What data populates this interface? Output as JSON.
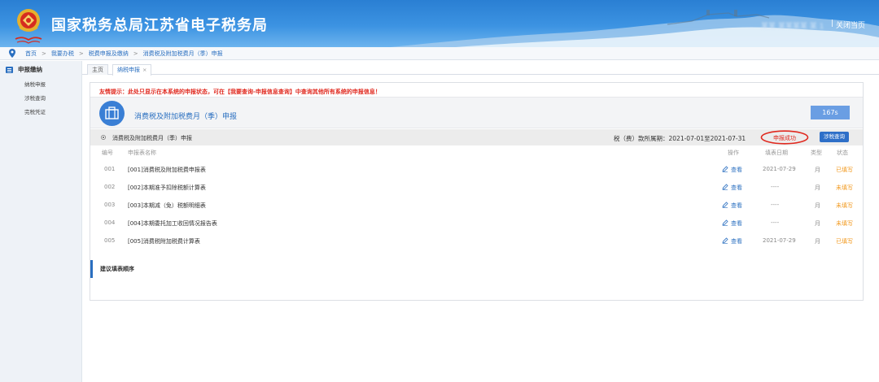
{
  "header": {
    "site_title": "国家税务总局江苏省电子税务局",
    "user_name": "某某 某某某某 某 1",
    "separator": "|",
    "close_label": "关闭当页"
  },
  "breadcrumb": [
    "首页",
    "我要办税",
    "税费申报及缴纳",
    "消费税及附加税费月（季）申报"
  ],
  "sidebar": {
    "title": "申报缴纳",
    "items": [
      {
        "label": "纳税申报"
      },
      {
        "label": "涉税查询"
      },
      {
        "label": "完税凭证"
      }
    ]
  },
  "tabs": [
    {
      "label": "主页",
      "active": false
    },
    {
      "label": "纳税申报",
      "close": "×",
      "active": true
    }
  ],
  "panel": {
    "tip": "友情提示：此处只显示在本系统的申报状态，可在【我要查询-申报信息查询】中查询其他所有系统的申报信息！",
    "form_title": "消费税及附加税费月（季）申报",
    "timer": "167s",
    "section_title": "消费税及附加税费月（季）申报",
    "period": "税（费）款所属期：2021-07-01至2021-07-31",
    "status": "申报成功",
    "query_button": "涉税查询",
    "columns": {
      "no": "编号",
      "name": "申报表名称",
      "op": "操作",
      "date": "填表日期",
      "type": "类型",
      "status": "状态"
    },
    "rows": [
      {
        "no": "001",
        "name": "[001]消费税及附加税费申报表",
        "op": "查看",
        "date": "2021-07-29",
        "type": "月",
        "status": "已填写"
      },
      {
        "no": "002",
        "name": "[002]本期准予扣除税额计算表",
        "op": "查看",
        "date": "----",
        "type": "月",
        "status": "未填写"
      },
      {
        "no": "003",
        "name": "[003]本期减（免）税额明细表",
        "op": "查看",
        "date": "----",
        "type": "月",
        "status": "未填写"
      },
      {
        "no": "004",
        "name": "[004]本期委托加工收回情况报告表",
        "op": "查看",
        "date": "----",
        "type": "月",
        "status": "未填写"
      },
      {
        "no": "005",
        "name": "[005]消费税附加税费计算表",
        "op": "查看",
        "date": "2021-07-29",
        "type": "月",
        "status": "已填写"
      }
    ],
    "order_title": "建议填表顺序"
  },
  "colors": {
    "header_blue": "#2a7fd3",
    "link_blue": "#2a6fc0",
    "warning_red": "#e0281e",
    "status_orange": "#f29a20",
    "timer_blue": "#6a9ee3"
  },
  "icons": [
    "emblem-icon",
    "location-pin-icon",
    "menu-icon",
    "briefcase-icon",
    "edit-icon",
    "radio-icon"
  ]
}
